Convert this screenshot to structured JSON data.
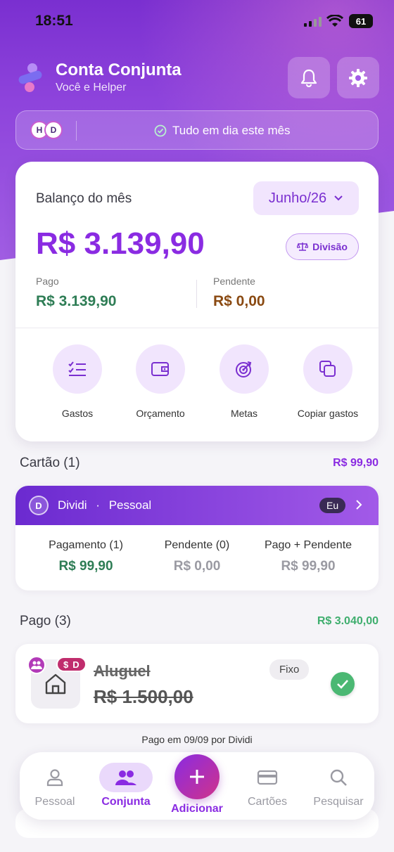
{
  "status_bar": {
    "time": "18:51",
    "battery": "61"
  },
  "header": {
    "title": "Conta Conjunta",
    "subtitle": "Você e Helper",
    "avatar_initials": [
      "H",
      "D"
    ],
    "status_message": "Tudo em dia este mês"
  },
  "summary": {
    "label": "Balanço do mês",
    "month": "Junho/26",
    "total": "R$ 3.139,90",
    "split_button": "Divisão",
    "paid_label": "Pago",
    "paid_value": "R$ 3.139,90",
    "pending_label": "Pendente",
    "pending_value": "R$ 0,00",
    "actions": [
      {
        "label": "Gastos",
        "icon": "checklist-icon"
      },
      {
        "label": "Orçamento",
        "icon": "wallet-icon"
      },
      {
        "label": "Metas",
        "icon": "target-icon"
      },
      {
        "label": "Copiar gastos",
        "icon": "copy-icon"
      }
    ]
  },
  "card_section": {
    "title": "Cartão (1)",
    "total": "R$ 99,90",
    "card": {
      "initial": "D",
      "name": "Dividi",
      "separator": "·",
      "type": "Pessoal",
      "owner_badge": "Eu",
      "columns": [
        {
          "header": "Pagamento (1)",
          "value": "R$ 99,90"
        },
        {
          "header": "Pendente (0)",
          "value": "R$ 0,00"
        },
        {
          "header": "Pago + Pendente",
          "value": "R$ 99,90"
        }
      ]
    }
  },
  "paid_section": {
    "title": "Pago (3)",
    "total": "R$ 3.040,00",
    "items": [
      {
        "name": "Aluguel",
        "amount": "R$ 1.500,00",
        "tag": "Fixo",
        "payer_badge": "D",
        "payer_badge_symbol": "$",
        "note": "Pago em 09/09 por Dividi"
      }
    ]
  },
  "tab_bar": {
    "tabs": [
      {
        "label": "Pessoal",
        "icon": "person-icon"
      },
      {
        "label": "Conjunta",
        "icon": "people-icon",
        "active": true
      },
      {
        "label": "Adicionar",
        "icon": "plus-icon"
      },
      {
        "label": "Cartões",
        "icon": "credit-card-icon"
      },
      {
        "label": "Pesquisar",
        "icon": "search-icon"
      }
    ]
  },
  "colors": {
    "accent": "#8a2be2",
    "paid_green": "#2e7d55",
    "pending_brown": "#8a4a12",
    "muted_gray": "#9a9aa2"
  }
}
